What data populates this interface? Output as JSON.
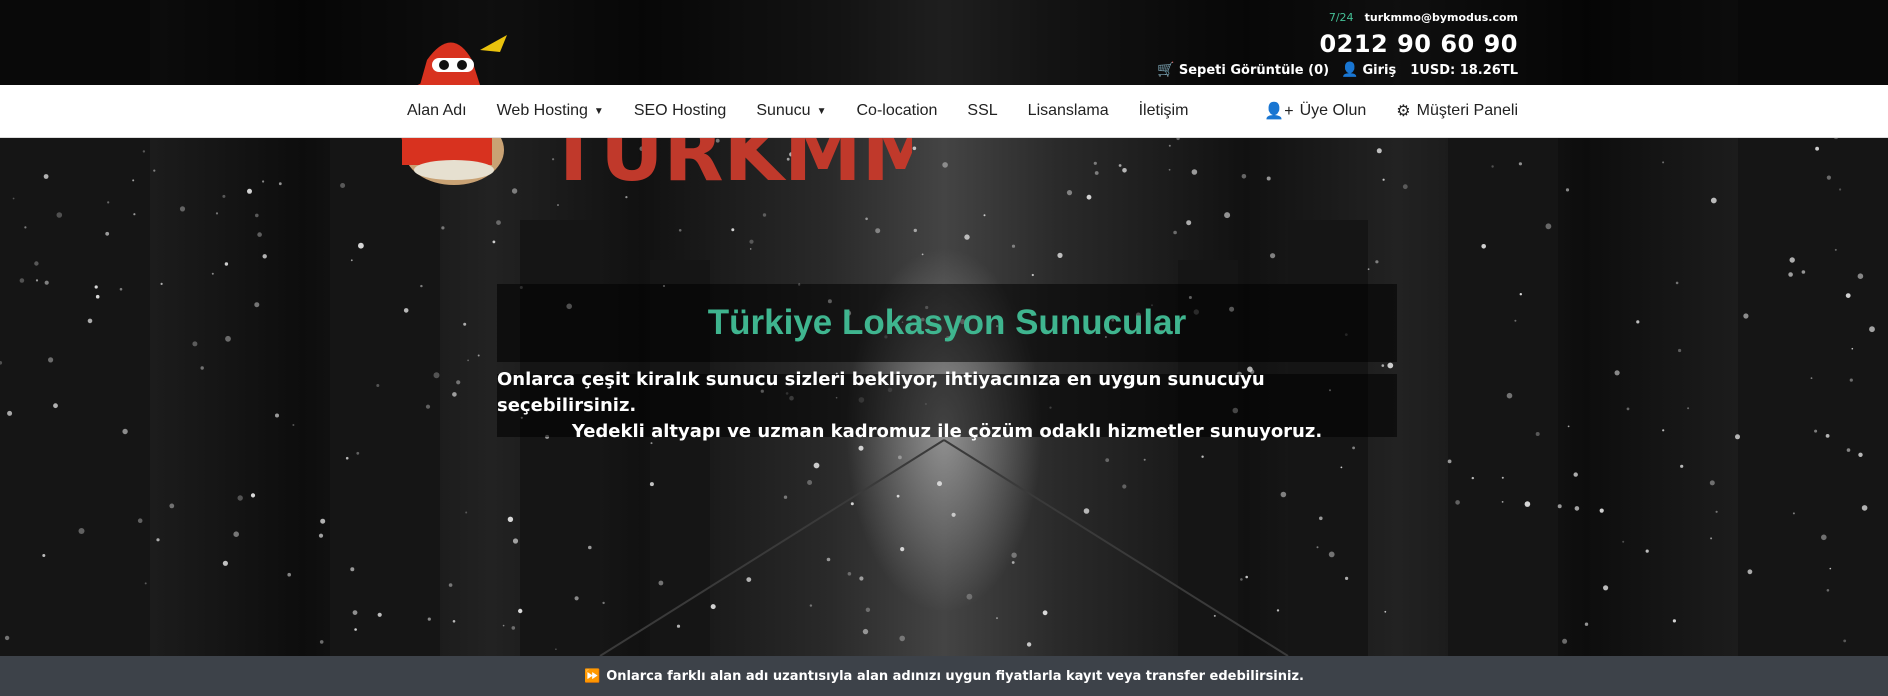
{
  "topbar": {
    "hours": "7/24",
    "email": "turkmmo@bymodus.com",
    "phone": "0212 90 60 90",
    "cart_label": "Sepeti Görüntüle (0)",
    "login_label": "Giriş",
    "usd_rate": "1USD: 18.26TL"
  },
  "logo": {
    "text": "TURKMMO"
  },
  "nav": {
    "items": [
      {
        "label": "Alan Adı"
      },
      {
        "label": "Web Hosting"
      },
      {
        "label": "SEO Hosting"
      },
      {
        "label": "Sunucu"
      },
      {
        "label": "Co-location"
      },
      {
        "label": "SSL"
      },
      {
        "label": "Lisanslama"
      },
      {
        "label": "İletişim"
      }
    ],
    "register_label": "Üye Olun",
    "panel_label": "Müşteri Paneli"
  },
  "hero": {
    "title": "Türkiye Lokasyon Sunucular",
    "line1": "Onlarca çeşit kiralık sunucu sizleri bekliyor, ihtiyacınıza en uygun sunucuyu seçebilirsiniz.",
    "line2": "Yedekli altyapı ve uzman kadromuz ile çözüm odaklı hizmetler sunuyoruz."
  },
  "footer_bar": {
    "text": "Onlarca farklı alan adı uzantısıyla alan adınızı uygun fiyatlarla kayıt veya transfer edebilirsiniz."
  },
  "colors": {
    "accent": "#3fb58f",
    "bottom_bar": "#3d4249"
  }
}
